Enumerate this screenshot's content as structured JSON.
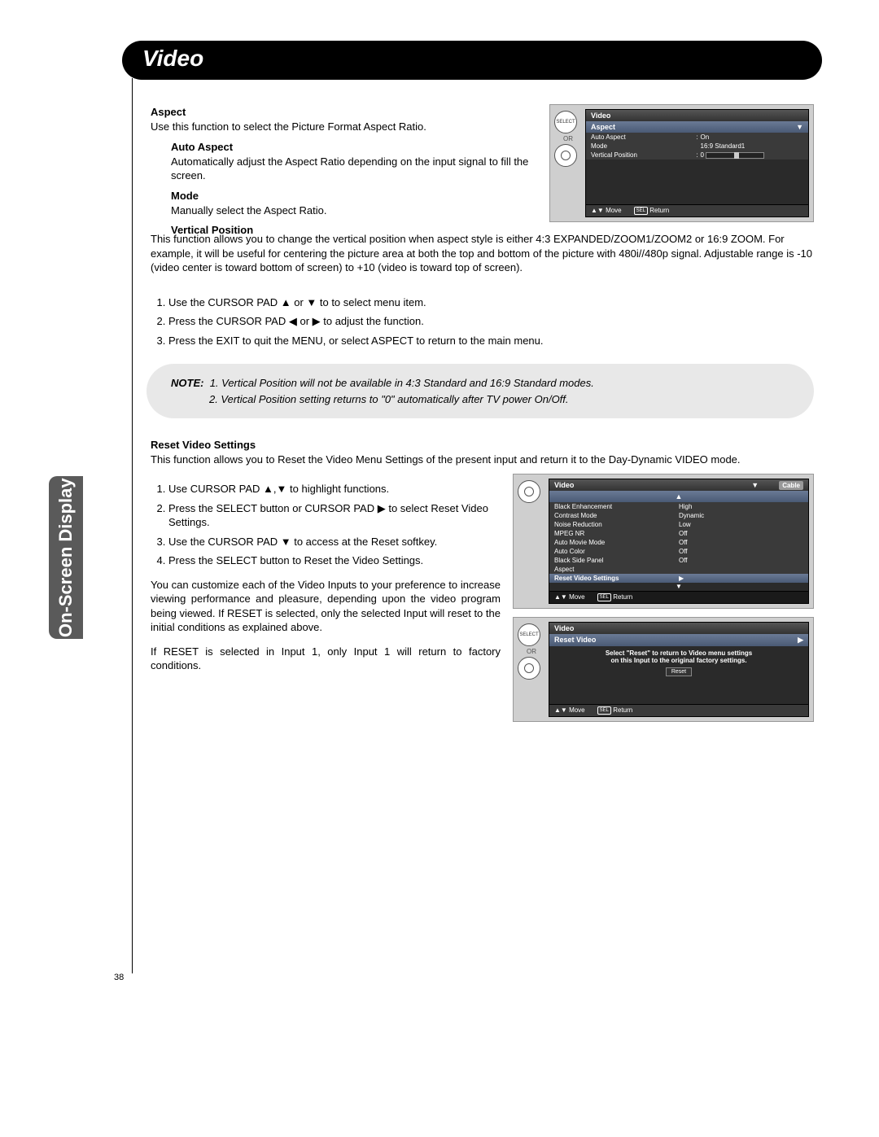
{
  "page_title": "Video",
  "sidebar_label": "On-Screen Display",
  "page_number": "38",
  "aspect": {
    "heading": "Aspect",
    "desc": "Use this function to select the Picture Format Aspect Ratio.",
    "auto_heading": "Auto Aspect",
    "auto_desc": "Automatically adjust the Aspect Ratio depending on the input signal to fill the screen.",
    "mode_heading": "Mode",
    "mode_desc": "Manually select the Aspect Ratio.",
    "vp_heading": "Vertical Position",
    "vp_desc": "This function allows you to change the vertical position when aspect style is either 4:3 EXPANDED/ZOOM1/ZOOM2 or 16:9 ZOOM. For example, it will be useful for centering the picture area at both the top and bottom of the picture with 480i//480p signal. Adjustable range is -10 (video center is toward bottom of screen) to +10 (video is toward top of screen)."
  },
  "steps1": [
    "Use the CURSOR PAD ▲ or ▼ to to select menu item.",
    "Press the CURSOR PAD ◀ or ▶ to adjust the function.",
    "Press the EXIT to quit the MENU, or select ASPECT to return to the main menu."
  ],
  "note": {
    "label": "NOTE:",
    "line1": "1. Vertical Position will not be available in 4:3 Standard and 16:9 Standard modes.",
    "line2": "2. Vertical Position setting returns to \"0\" automatically after TV power On/Off."
  },
  "reset": {
    "heading": "Reset Video Settings",
    "desc": "This function allows you to Reset the Video Menu Settings of the present input and return it to the Day-Dynamic VIDEO mode.",
    "steps": [
      "Use CURSOR PAD ▲,▼ to highlight functions.",
      "Press the SELECT button or CURSOR PAD ▶ to select Reset Video Settings.",
      "Use the CURSOR PAD ▼ to access at the Reset softkey.",
      "Press the SELECT button to Reset the Video Settings."
    ],
    "para1": "You can customize each of the Video Inputs to your preference to increase viewing performance and pleasure, depending upon the video program being viewed. If RESET is selected, only the selected Input will reset to the initial conditions as explained above.",
    "para2": "If RESET is selected in Input 1, only Input 1 will return to factory conditions."
  },
  "osd1": {
    "title": "Video",
    "sub": "Aspect",
    "or": "OR",
    "select": "SELECT",
    "rows": [
      {
        "k": "Auto Aspect",
        "v": "On"
      },
      {
        "k": "Mode",
        "v": "16:9  Standard1"
      },
      {
        "k": "Vertical Position",
        "v": "0"
      }
    ],
    "move": "Move",
    "sel": "SEL",
    "return": "Return"
  },
  "osd2": {
    "title": "Video",
    "badge": "Cable",
    "rows": [
      {
        "k": "Black Enhancement",
        "v": "High"
      },
      {
        "k": "Contrast Mode",
        "v": "Dynamic"
      },
      {
        "k": "Noise Reduction",
        "v": "Low"
      },
      {
        "k": "MPEG NR",
        "v": "Off"
      },
      {
        "k": "Auto Movie Mode",
        "v": "Off"
      },
      {
        "k": "Auto Color",
        "v": "Off"
      },
      {
        "k": "Black Side Panel",
        "v": "Off"
      },
      {
        "k": "Aspect",
        "v": ""
      },
      {
        "k": "Reset Video Settings",
        "v": "▶",
        "sel": true
      }
    ],
    "move": "Move",
    "sel": "SEL",
    "return": "Return"
  },
  "osd3": {
    "title": "Video",
    "sub": "Reset Video",
    "or": "OR",
    "select": "SELECT",
    "msg1": "Select \"Reset\" to return to Video menu settings",
    "msg2": "on this Input to the original factory settings.",
    "reset_btn": "Reset",
    "move": "Move",
    "sel": "SEL",
    "return": "Return"
  }
}
